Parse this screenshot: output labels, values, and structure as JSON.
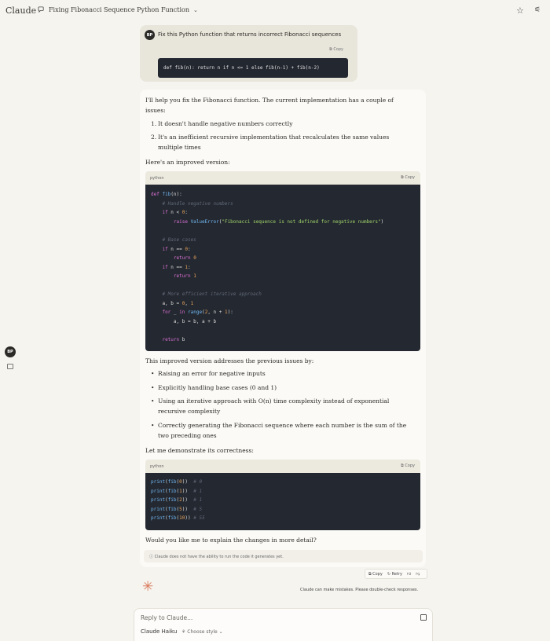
{
  "header": {
    "brand": "Claude",
    "chat_title": "Fixing Fibonacci Sequence Python Function"
  },
  "sidebar": {
    "avatar_initials": "BP"
  },
  "user_message": {
    "avatar_initials": "BP",
    "text": "Fix this Python function that returns incorrect Fibonacci sequences",
    "copy_label": "Copy",
    "code": "def fib(n): return n if n <= 1 else fib(n-1) + fib(n-2)"
  },
  "reply": {
    "intro_line1": "I'll help you fix the Fibonacci function. The current implementation has a couple of",
    "intro_line2": "issues:",
    "issues": [
      {
        "num": "1.",
        "line1": "It doesn't handle negative numbers correctly",
        "line2": ""
      },
      {
        "num": "2.",
        "line1": "It's an inefficient recursive implementation that recalculates the same values",
        "line2": "multiple times"
      }
    ],
    "improved_label": "Here's an improved version:",
    "code_block_1": {
      "lang": "python",
      "copy_label": "Copy",
      "lines": [
        "def fib(n):",
        "    # Handle negative numbers",
        "    if n < 0:",
        "        raise ValueError(\"Fibonacci sequence is not defined for negative numbers\")",
        "",
        "    # Base cases",
        "    if n == 0:",
        "        return 0",
        "    if n == 1:",
        "        return 1",
        "",
        "    # More efficient iterative approach",
        "    a, b = 0, 1",
        "    for _ in range(2, n + 1):",
        "        a, b = b, a + b",
        "",
        "    return b"
      ]
    },
    "addresses_label": "This improved version addresses the previous issues by:",
    "points": [
      {
        "line1": "Raising an error for negative inputs",
        "line2": ""
      },
      {
        "line1": "Explicitly handling base cases (0 and 1)",
        "line2": ""
      },
      {
        "line1": "Using an iterative approach with O(n) time complexity instead of exponential",
        "line2": "recursive complexity"
      },
      {
        "line1": "Correctly generating the Fibonacci sequence where each number is the sum of the",
        "line2": "two preceding ones"
      }
    ],
    "demonstrate_label": "Let me demonstrate its correctness:",
    "code_block_2": {
      "lang": "python",
      "copy_label": "Copy",
      "lines": [
        "print(fib(0))  # 0",
        "print(fib(1))  # 1",
        "print(fib(2))  # 1",
        "print(fib(5))  # 5",
        "print(fib(10)) # 55"
      ]
    },
    "followup": "Would you like me to explain the changes in more detail?",
    "notice": "Claude does not have the ability to run the code it generates yet."
  },
  "actions": {
    "copy": "Copy",
    "retry": "Retry"
  },
  "warning": "Claude can make mistakes. Please double-check responses.",
  "composer": {
    "placeholder": "Reply to Claude...",
    "model": "Claude Haiku",
    "style": "Choose style"
  }
}
